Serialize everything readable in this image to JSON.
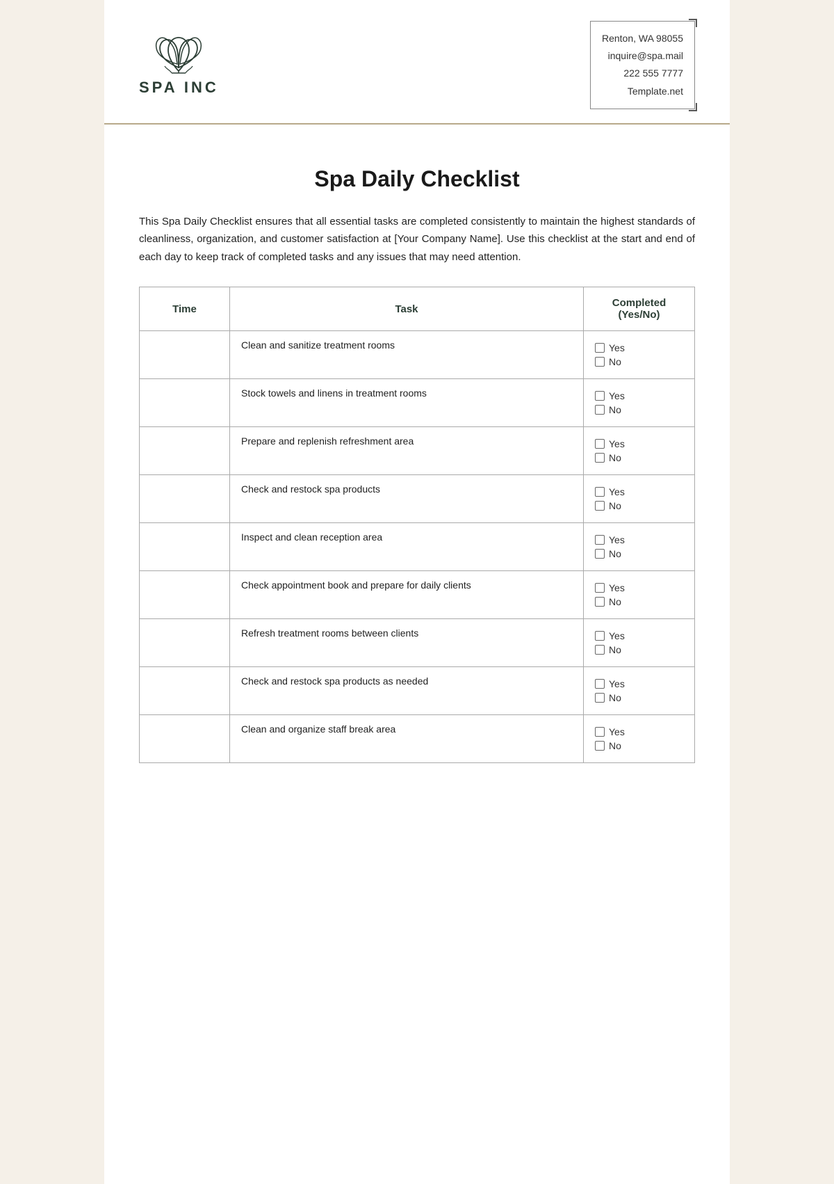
{
  "company": {
    "name": "SPA INC",
    "address": "Renton, WA 98055",
    "email": "inquire@spa.mail",
    "phone": "222 555 7777",
    "website": "Template.net"
  },
  "document": {
    "title": "Spa Daily Checklist",
    "description": "This Spa Daily Checklist ensures that all essential tasks are completed consistently to maintain the highest standards of cleanliness, organization, and customer satisfaction at [Your Company Name]. Use this checklist at the start and end of each day to keep track of completed tasks and any issues that may need attention."
  },
  "table": {
    "headers": {
      "time": "Time",
      "task": "Task",
      "completed": "Completed",
      "completed_sub": "(Yes/No)"
    },
    "rows": [
      {
        "time": "",
        "task": "Clean and sanitize treatment rooms"
      },
      {
        "time": "",
        "task": "Stock towels and linens in treatment rooms"
      },
      {
        "time": "",
        "task": "Prepare and replenish refreshment area"
      },
      {
        "time": "",
        "task": "Check and restock spa products"
      },
      {
        "time": "",
        "task": "Inspect and clean reception area"
      },
      {
        "time": "",
        "task": "Check appointment book and prepare for daily clients"
      },
      {
        "time": "",
        "task": "Refresh treatment rooms between clients"
      },
      {
        "time": "",
        "task": "Check and restock spa products as needed"
      },
      {
        "time": "",
        "task": "Clean and organize staff break area"
      }
    ],
    "options": [
      "Yes",
      "No"
    ]
  }
}
